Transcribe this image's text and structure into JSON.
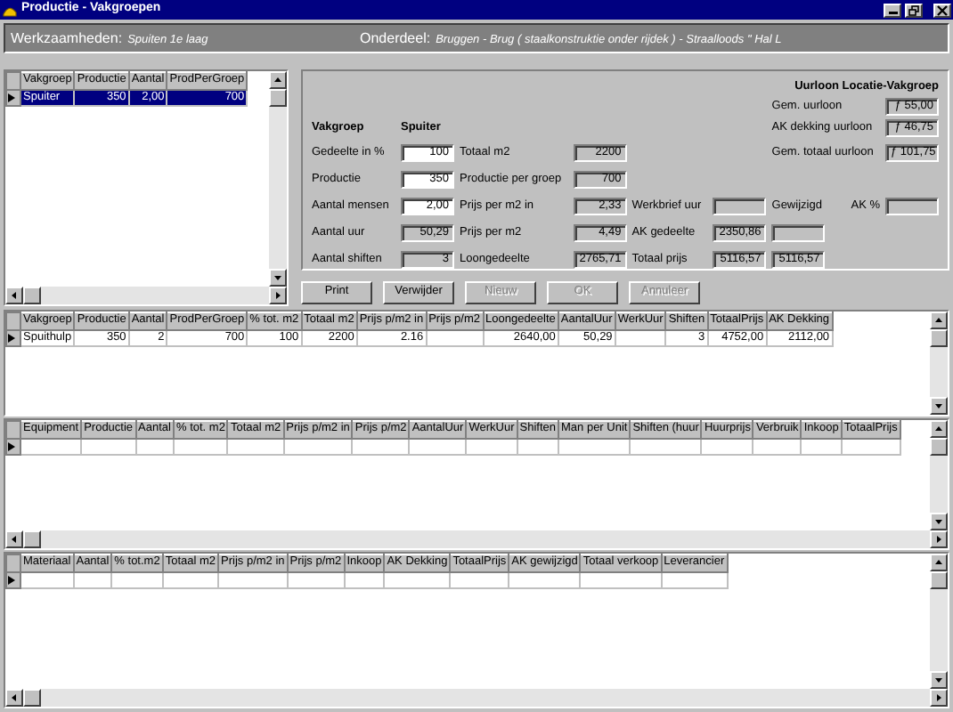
{
  "window": {
    "title": "Productie - Vakgroepen"
  },
  "header": {
    "left_label": "Werkzaamheden:",
    "left_value": "Spuiten 1e laag",
    "right_label": "Onderdeel:",
    "right_value": "Bruggen - Brug ( staalkonstruktie onder rijdek ) - Straalloods \" Hal L"
  },
  "vakgroep_grid": {
    "columns": [
      "Vakgroep",
      "Productie",
      "Aantal",
      "ProdPerGroep"
    ],
    "rows": [
      {
        "cells": [
          "Spuiter",
          "350",
          "2,00",
          "700"
        ],
        "selected": true,
        "current": true
      }
    ]
  },
  "form": {
    "heading_label": "Vakgroep",
    "heading_value": "Spuiter",
    "uurloon_title": "Uurloon  Locatie-Vakgroep",
    "uurloon": [
      {
        "label": "Gem. uurloon",
        "value": "ƒ 55,00"
      },
      {
        "label": "AK dekking uurloon",
        "value": "ƒ 46,75"
      },
      {
        "label": "Gem. totaal uurloon",
        "value": "ƒ 101,75"
      }
    ],
    "column_1": [
      {
        "label": "Gedeelte in %",
        "value": "100",
        "editable": true
      },
      {
        "label": "Productie",
        "value": "350",
        "editable": true
      },
      {
        "label": "Aantal mensen",
        "value": "2,00",
        "editable": true
      },
      {
        "label": "Aantal uur",
        "value": "50,29",
        "editable": false
      },
      {
        "label": "Aantal shiften",
        "value": "3",
        "editable": false
      }
    ],
    "column_2": [
      {
        "label": "Totaal m2",
        "value": "2200"
      },
      {
        "label": "Productie per groep",
        "value": "700"
      },
      {
        "label": "Prijs per m2 in",
        "value": "2,33"
      },
      {
        "label": "Prijs per m2",
        "value": "4,49"
      },
      {
        "label": "Loongedeelte",
        "value": "2765,71"
      }
    ],
    "column_3": [
      {
        "label": "Werkbrief uur"
      },
      {
        "label": "AK gedeelte",
        "value": "2350,86"
      },
      {
        "label": "Totaal prijs",
        "value": "5116,57"
      }
    ],
    "gewijzigd_label": "Gewijzigd",
    "gewijzigd_value": "5116,57",
    "ak_percent_label": "AK %"
  },
  "buttons": [
    {
      "label": "Print",
      "disabled": false
    },
    {
      "label": "Verwijder",
      "disabled": false
    },
    {
      "label": "Nieuw",
      "disabled": true
    },
    {
      "label": "OK",
      "disabled": true
    },
    {
      "label": "Annuleer",
      "disabled": true
    }
  ],
  "spuithulp_grid": {
    "columns": [
      "Vakgroep",
      "Productie",
      "Aantal",
      "ProdPerGroep",
      "% tot. m2",
      "Totaal m2",
      "Prijs p/m2 in",
      "Prijs p/m2",
      "Loongedeelte",
      "AantalUur",
      "WerkUur",
      "Shiften",
      "TotaalPrijs",
      "AK Dekking"
    ],
    "rows": [
      {
        "cells": [
          "Spuithulp",
          "350",
          "2",
          "700",
          "100",
          "2200",
          "2.16",
          null,
          "2640,00",
          "50,29",
          null,
          "3",
          "4752,00",
          "2112,00"
        ],
        "selected": false,
        "current": true
      }
    ]
  },
  "equipment_grid": {
    "columns": [
      "Equipment",
      "Productie",
      "Aantal",
      "% tot. m2",
      "Totaal m2",
      "Prijs p/m2 in",
      "Prijs p/m2",
      "AantalUur",
      "WerkUur",
      "Shiften",
      "Man per Unit",
      "Shiften (huur",
      "Huurprijs",
      "Verbruik",
      "Inkoop",
      "TotaalPrijs"
    ],
    "new_row": {
      "current": true
    }
  },
  "materiaal_grid": {
    "columns": [
      "Materiaal",
      "Aantal",
      "% tot.m2",
      "Totaal m2",
      "Prijs p/m2 in",
      "Prijs p/m2",
      "Inkoop",
      "AK Dekking",
      "TotaalPrijs",
      "AK gewijzigd",
      "Totaal verkoop",
      "Leverancier"
    ],
    "new_row": {
      "current": true
    }
  }
}
